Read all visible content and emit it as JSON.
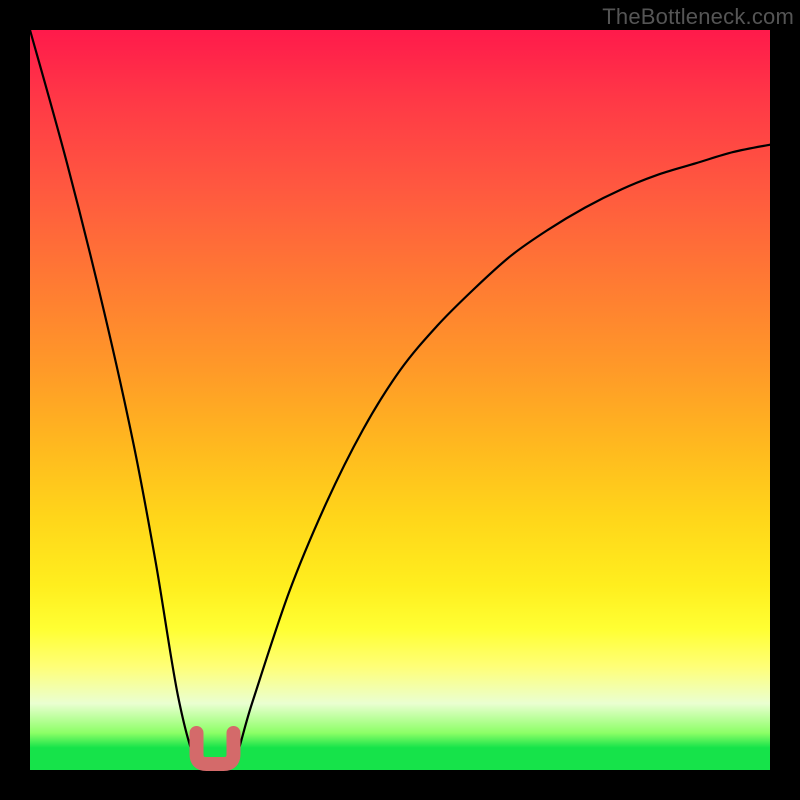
{
  "watermark": "TheBottleneck.com",
  "chart_data": {
    "type": "line",
    "title": "",
    "xlabel": "",
    "ylabel": "",
    "xlim": [
      0,
      100
    ],
    "ylim": [
      0,
      100
    ],
    "grid": false,
    "legend": false,
    "series": [
      {
        "name": "bottleneck-curve",
        "x": [
          0,
          5,
          10,
          14,
          17,
          20,
          22.5,
          25,
          27.5,
          30,
          35,
          40,
          45,
          50,
          55,
          60,
          65,
          70,
          75,
          80,
          85,
          90,
          95,
          100
        ],
        "y": [
          100,
          82,
          62,
          44,
          28,
          10,
          1,
          0,
          1,
          9,
          24,
          36,
          46,
          54,
          60,
          65,
          69.5,
          73,
          76,
          78.5,
          80.5,
          82,
          83.5,
          84.5
        ]
      }
    ],
    "annotations": [
      {
        "name": "dip-marker",
        "shape": "u",
        "color": "#d46a6a",
        "x_range": [
          22.5,
          27.5
        ],
        "y_range": [
          0,
          5
        ]
      }
    ],
    "background_gradient": {
      "direction": "vertical",
      "stops": [
        {
          "pos": 0,
          "color": "#ff1a4b"
        },
        {
          "pos": 50,
          "color": "#ff9a28"
        },
        {
          "pos": 80,
          "color": "#ffff33"
        },
        {
          "pos": 95,
          "color": "#8cff66"
        },
        {
          "pos": 100,
          "color": "#16e34a"
        }
      ]
    }
  }
}
